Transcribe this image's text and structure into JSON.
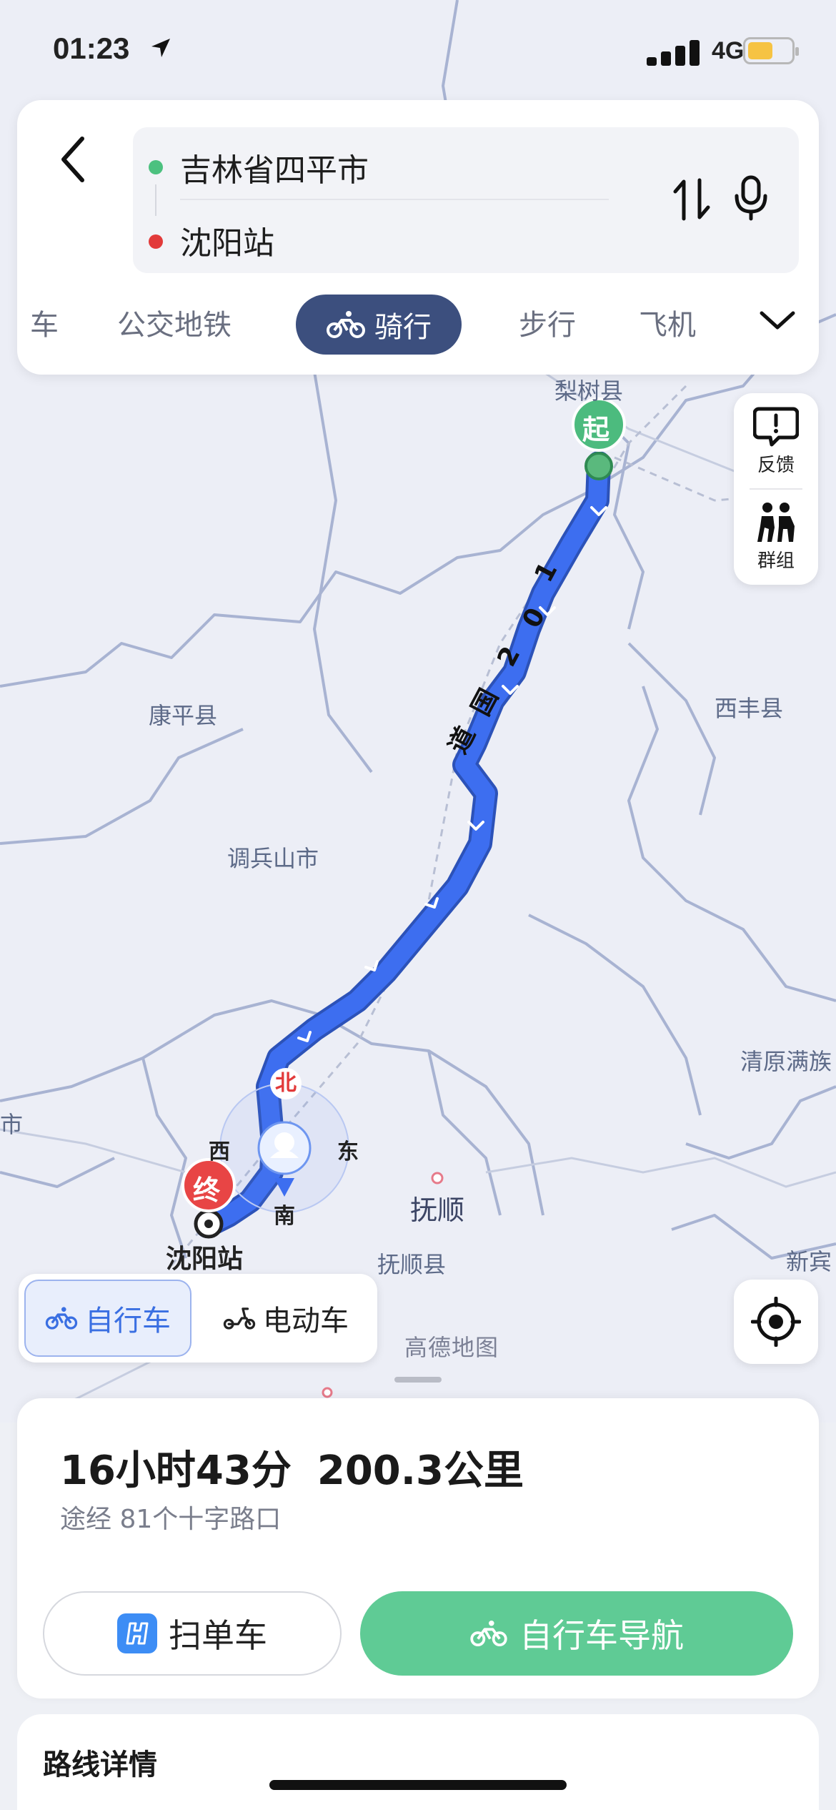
{
  "status_bar": {
    "time": "01:23",
    "network": "4G",
    "battery_color": "#f6c343"
  },
  "search": {
    "origin": "吉林省四平市",
    "destination": "沈阳站",
    "origin_dot_color": "#4cc17f",
    "destination_dot_color": "#e23a3a"
  },
  "tabs": [
    {
      "label": "车"
    },
    {
      "label": "公交地铁"
    },
    {
      "label": "骑行",
      "active": true
    },
    {
      "label": "步行"
    },
    {
      "label": "飞机"
    }
  ],
  "side_tools": {
    "feedback": "反馈",
    "group": "群组"
  },
  "map": {
    "start_marker": "起",
    "end_marker": "终",
    "route_road": [
      "1",
      "0",
      "2",
      "国",
      "道"
    ],
    "compass": {
      "north": "北",
      "south": "南",
      "east": "东",
      "west": "西"
    },
    "labels": {
      "lishu": "梨树县",
      "kangping": "康平县",
      "xifeng": "西丰县",
      "diaobingshan": "调兵山市",
      "qingyuan": "清原满族",
      "shenyang_station": "沈阳站",
      "fushun": "抚顺",
      "fushun_county": "抚顺县",
      "xinbin": "新宾",
      "left_edge": "市"
    },
    "route_color": "#3d6ef0",
    "attribution": "高德地图"
  },
  "vehicle": {
    "bicycle": "自行车",
    "ebike": "电动车"
  },
  "result": {
    "duration": "16小时43分",
    "distance": "200.3公里",
    "intersections": "途经 81个十字路口",
    "scan_button": "扫单车",
    "nav_button": "自行车导航",
    "nav_color": "#5fcb95"
  },
  "details": {
    "title": "路线详情"
  }
}
